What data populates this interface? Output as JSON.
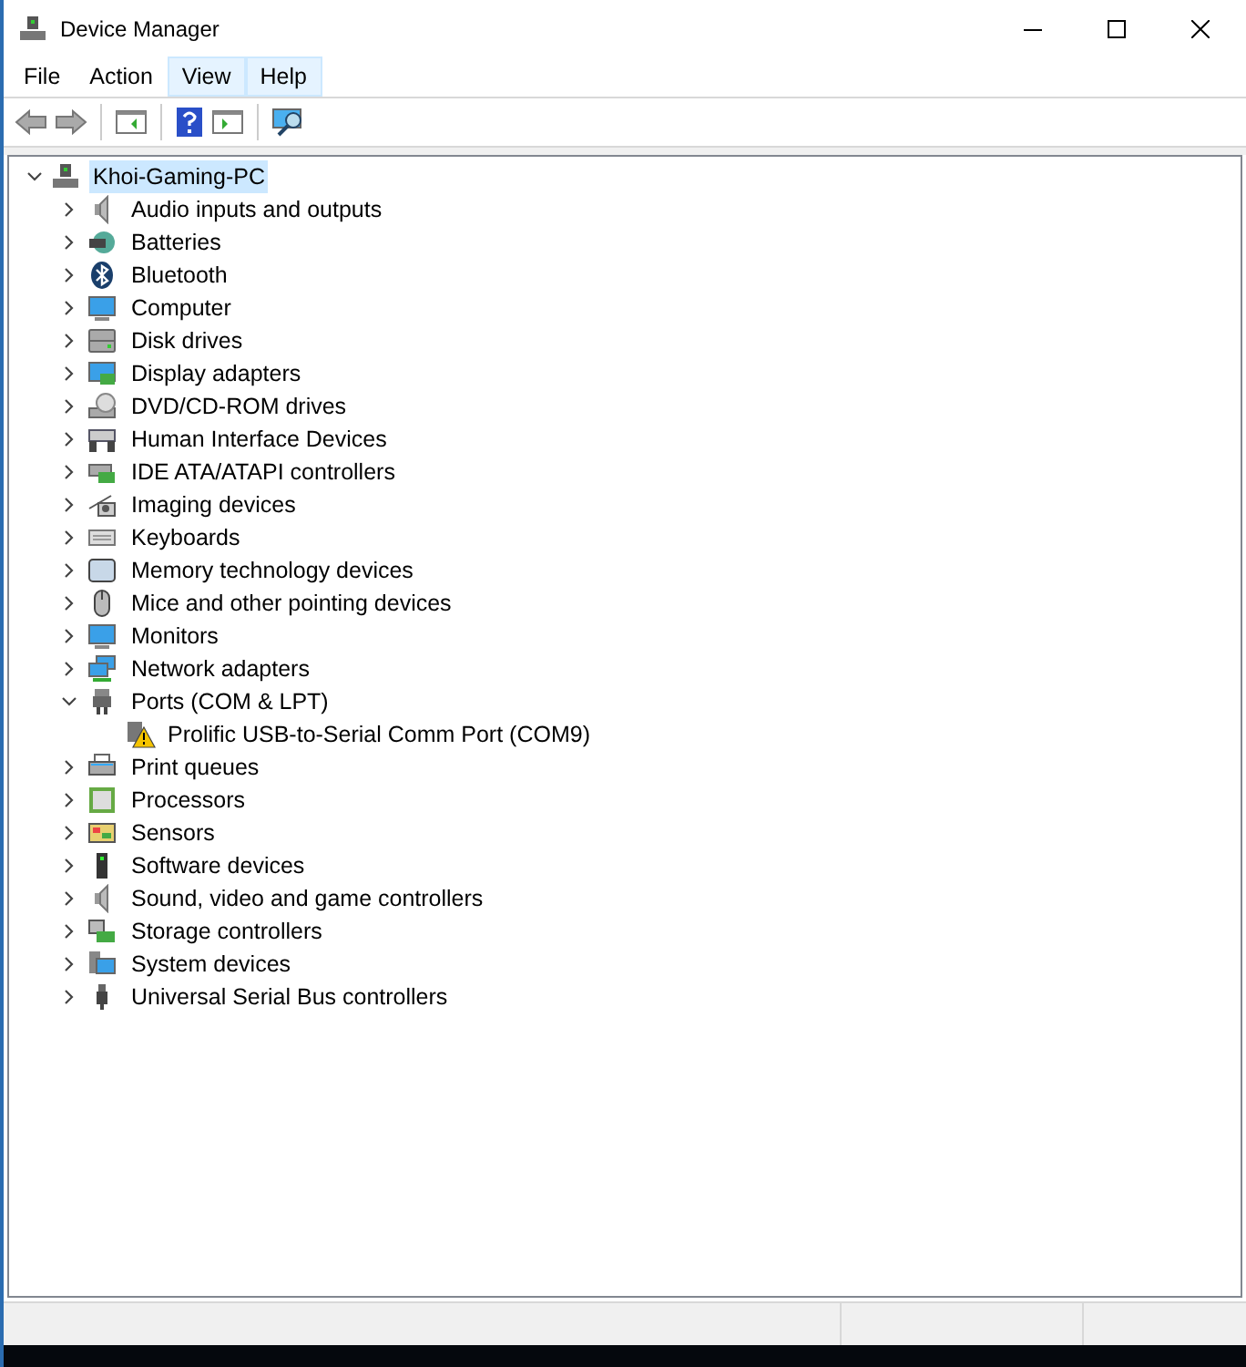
{
  "window": {
    "title": "Device Manager"
  },
  "menu": [
    {
      "label": "File",
      "hot": false
    },
    {
      "label": "Action",
      "hot": false
    },
    {
      "label": "View",
      "hot": true
    },
    {
      "label": "Help",
      "hot": true
    }
  ],
  "tree": {
    "label": "Khoi-Gaming-PC",
    "selected": true,
    "expanded": true,
    "children": [
      {
        "label": "Audio inputs and outputs",
        "expanded": false
      },
      {
        "label": "Batteries",
        "expanded": false
      },
      {
        "label": "Bluetooth",
        "expanded": false
      },
      {
        "label": "Computer",
        "expanded": false
      },
      {
        "label": "Disk drives",
        "expanded": false
      },
      {
        "label": "Display adapters",
        "expanded": false
      },
      {
        "label": "DVD/CD-ROM drives",
        "expanded": false
      },
      {
        "label": "Human Interface Devices",
        "expanded": false
      },
      {
        "label": "IDE ATA/ATAPI controllers",
        "expanded": false
      },
      {
        "label": "Imaging devices",
        "expanded": false
      },
      {
        "label": "Keyboards",
        "expanded": false
      },
      {
        "label": "Memory technology devices",
        "expanded": false
      },
      {
        "label": "Mice and other pointing devices",
        "expanded": false
      },
      {
        "label": "Monitors",
        "expanded": false
      },
      {
        "label": "Network adapters",
        "expanded": false
      },
      {
        "label": "Ports (COM & LPT)",
        "expanded": true,
        "children": [
          {
            "label": "Prolific USB-to-Serial Comm Port (COM9)",
            "warning": true
          }
        ]
      },
      {
        "label": "Print queues",
        "expanded": false
      },
      {
        "label": "Processors",
        "expanded": false
      },
      {
        "label": "Sensors",
        "expanded": false
      },
      {
        "label": "Software devices",
        "expanded": false
      },
      {
        "label": "Sound, video and game controllers",
        "expanded": false
      },
      {
        "label": "Storage controllers",
        "expanded": false
      },
      {
        "label": "System devices",
        "expanded": false
      },
      {
        "label": "Universal Serial Bus controllers",
        "expanded": false
      }
    ]
  }
}
